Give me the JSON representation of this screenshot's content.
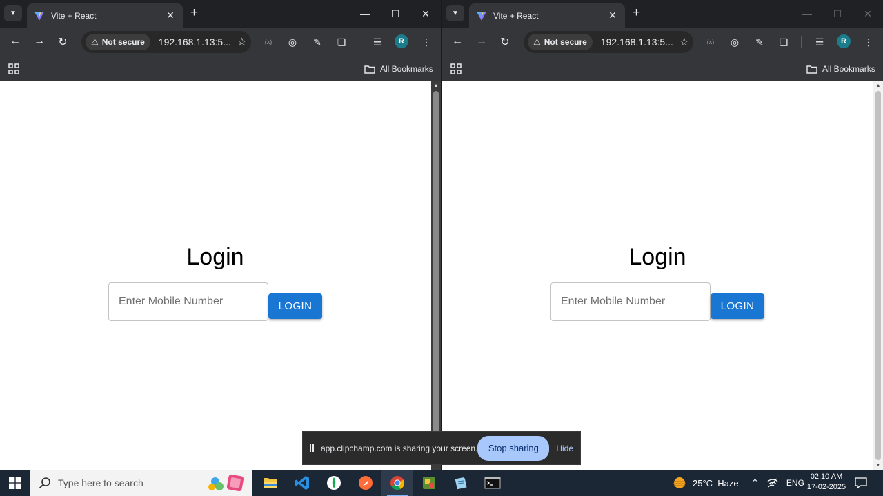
{
  "windows": [
    {
      "tab_title": "Vite + React",
      "security_label": "Not secure",
      "url": "192.168.1.13:5...",
      "bookmarks_label": "All Bookmarks",
      "avatar_letter": "R",
      "page": {
        "title": "Login",
        "input_placeholder": "Enter Mobile Number",
        "input_value": "",
        "login_button": "LOGIN"
      }
    },
    {
      "tab_title": "Vite + React",
      "security_label": "Not secure",
      "url": "192.168.1.13:5...",
      "bookmarks_label": "All Bookmarks",
      "avatar_letter": "R",
      "page": {
        "title": "Login",
        "input_placeholder": "Enter Mobile Number",
        "input_value": "",
        "login_button": "LOGIN"
      }
    }
  ],
  "share_bar": {
    "message": "app.clipchamp.com is sharing your screen.",
    "stop_label": "Stop sharing",
    "hide_label": "Hide"
  },
  "taskbar": {
    "search_placeholder": "Type here to search",
    "weather": "25°C  Haze",
    "language": "ENG",
    "time": "02:10 AM",
    "date": "17-02-2025"
  },
  "colors": {
    "login_button": "#1976d2",
    "stop_sharing": "#a8c7fa",
    "avatar": "#1b7d8c"
  }
}
